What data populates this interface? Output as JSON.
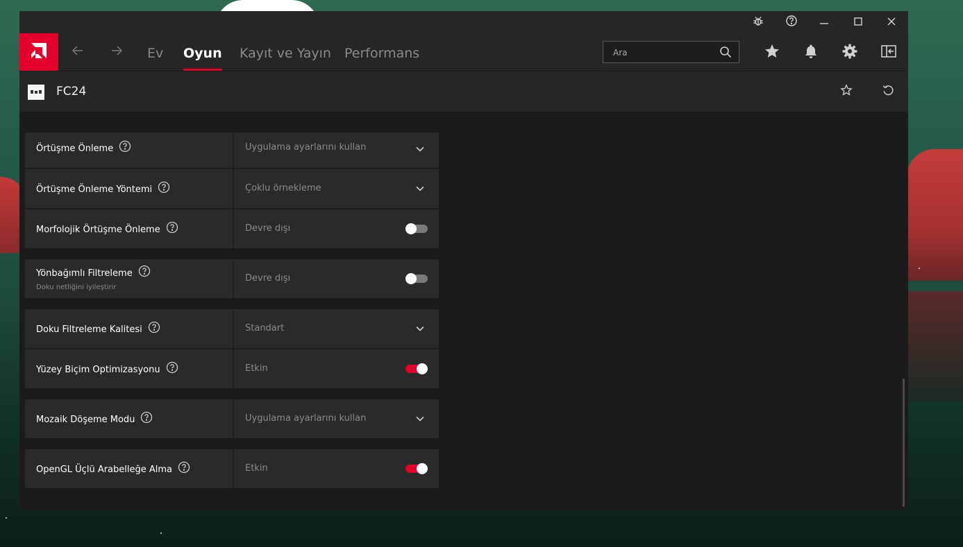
{
  "titlebar": {
    "buttons": [
      "bug-icon",
      "help-icon",
      "minimize-icon",
      "maximize-icon",
      "close-icon"
    ]
  },
  "nav": {
    "tabs": [
      {
        "label": "Ev",
        "active": false
      },
      {
        "label": "Oyun",
        "active": true
      },
      {
        "label": "Kayıt ve Yayın",
        "active": false
      },
      {
        "label": "Performans",
        "active": false
      }
    ],
    "search_placeholder": "Ara",
    "icons": [
      "star-icon",
      "bell-icon",
      "gear-icon",
      "sidebar-toggle-icon"
    ]
  },
  "game": {
    "title": "FC24"
  },
  "settings": {
    "cards": [
      {
        "rows": [
          {
            "label": "Örtüşme Önleme",
            "value": "Uygulama ayarlarını kullan",
            "control": "dropdown"
          },
          {
            "label": "Örtüşme Önleme Yöntemi",
            "value": "Çoklu örnekleme",
            "control": "dropdown"
          },
          {
            "label": "Morfolojik Örtüşme Önleme",
            "value": "Devre dışı",
            "control": "toggle",
            "enabled": false
          }
        ]
      },
      {
        "rows": [
          {
            "label": "Yönbağımlı Filtreleme",
            "sublabel": "Doku netliğini iyileştirir",
            "value": "Devre dışı",
            "control": "toggle",
            "enabled": false
          }
        ]
      },
      {
        "rows": [
          {
            "label": "Doku Filtreleme Kalitesi",
            "value": "Standart",
            "control": "dropdown"
          },
          {
            "label": "Yüzey Biçim Optimizasyonu",
            "value": "Etkin",
            "control": "toggle",
            "enabled": true
          }
        ]
      },
      {
        "rows": [
          {
            "label": "Mozaik Döşeme Modu",
            "value": "Uygulama ayarlarını kullan",
            "control": "dropdown"
          }
        ]
      },
      {
        "rows": [
          {
            "label": "OpenGL Üçlü Arabelleğe Alma",
            "value": "Etkin",
            "control": "toggle",
            "enabled": true
          }
        ]
      }
    ]
  },
  "colors": {
    "accent": "#e4002b",
    "panel": "#2a2a2a",
    "background": "#1b1b1b",
    "toggle_off": "#7a7a7a"
  }
}
